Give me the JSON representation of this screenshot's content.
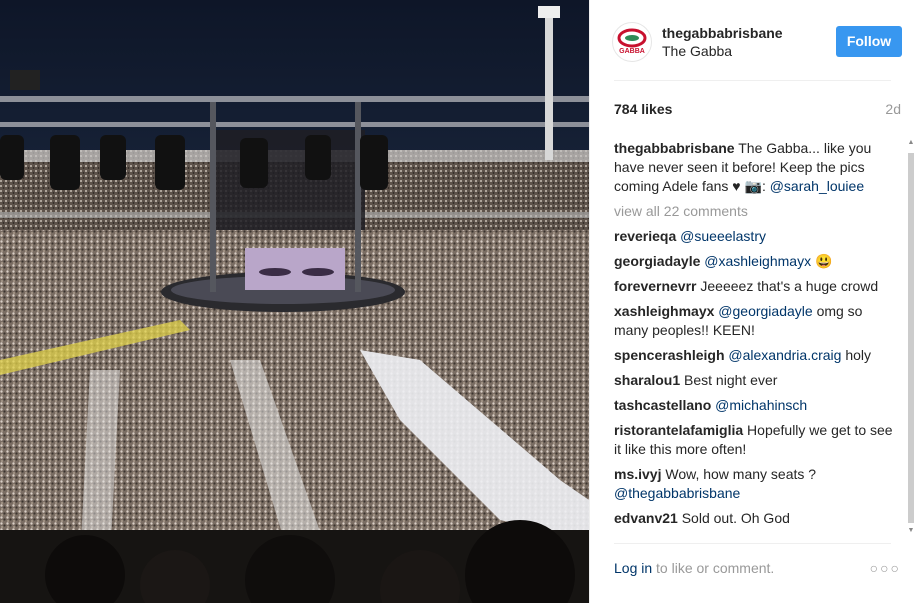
{
  "account": {
    "username": "thegabbabrisbane",
    "location": "The Gabba",
    "avatar_text": "GABBA"
  },
  "actions": {
    "follow_label": "Follow"
  },
  "stats": {
    "likes": "784 likes",
    "age": "2d"
  },
  "caption": {
    "user": "thegabbabrisbane",
    "text": "The Gabba... like you have never seen it before! Keep the pics coming Adele fans",
    "heart": "♥",
    "camera": "📷",
    "sep": ":",
    "mention": "@sarah_louiee"
  },
  "view_all": "view all 22 comments",
  "comments": [
    {
      "user": "reverieqa",
      "mention": "@sueeelastry",
      "text": ""
    },
    {
      "user": "georgiadayle",
      "mention": "@xashleighmayx",
      "text": "😃"
    },
    {
      "user": "forevernevrr",
      "mention": "",
      "text": "Jeeeeez that's a huge crowd"
    },
    {
      "user": "xashleighmayx",
      "mention": "@georgiadayle",
      "text": "omg so many peoples!! KEEN!"
    },
    {
      "user": "spencerashleigh",
      "mention": "@alexandria.craig",
      "text": "holy"
    },
    {
      "user": "sharalou1",
      "mention": "",
      "text": "Best night ever"
    },
    {
      "user": "tashcastellano",
      "mention": "@michahinsch",
      "text": ""
    },
    {
      "user": "ristorantelafamiglia",
      "mention": "",
      "text": "Hopefully we get to see it like this more often!"
    },
    {
      "user": "ms.ivyj",
      "mention": "",
      "text": "Wow, how many seats ?",
      "mention_after": "@thegabbabrisbane"
    },
    {
      "user": "edvanv21",
      "mention": "",
      "text": "Sold out. Oh God"
    }
  ],
  "footer": {
    "login": "Log in",
    "rest": " to like or comment.",
    "more": "○○○"
  },
  "colors": {
    "accent": "#3897f0",
    "mention": "#003569",
    "muted": "#999999"
  }
}
